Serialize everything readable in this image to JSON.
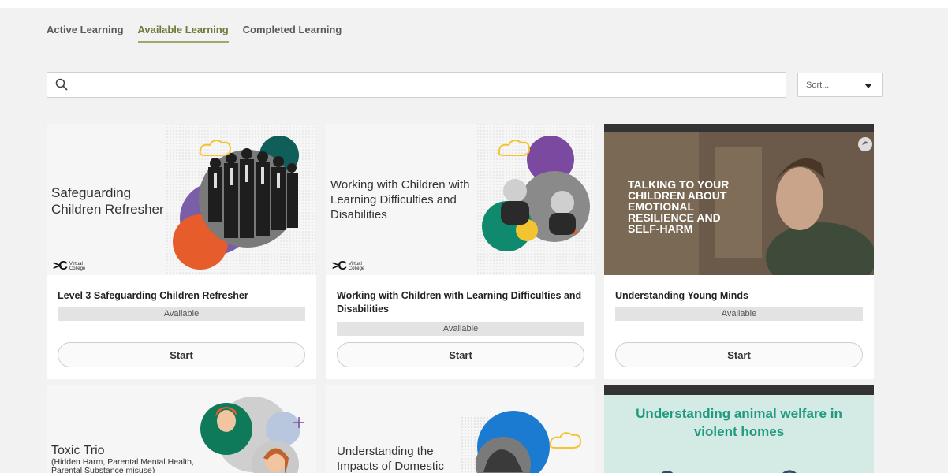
{
  "tabs": [
    {
      "label": "Active Learning",
      "active": false
    },
    {
      "label": "Available Learning",
      "active": true
    },
    {
      "label": "Completed Learning",
      "active": false
    }
  ],
  "search": {
    "placeholder": "",
    "value": ""
  },
  "sort": {
    "selected": "Sort..."
  },
  "cards": [
    {
      "image_title": "Safeguarding Children Refresher",
      "logo_line1": "Virtual",
      "logo_line2": "College",
      "title": "Level 3 Safeguarding Children Refresher",
      "status": "Available",
      "button": "Start"
    },
    {
      "image_title": "Working with Children with Learning Difficulties and Disabilities",
      "logo_line1": "Virtual",
      "logo_line2": "College",
      "title": "Working with Children with Learning Difficulties and Disabilities",
      "status": "Available",
      "button": "Start"
    },
    {
      "image_title": "TALKING TO YOUR CHILDREN ABOUT EMOTIONAL RESILIENCE AND SELF-HARM",
      "title": "Understanding Young Minds",
      "status": "Available",
      "button": "Start"
    },
    {
      "image_title": "Toxic Trio",
      "image_subtitle": "(Hidden Harm, Parental Mental Health, Parental Substance misuse)"
    },
    {
      "image_title": "Understanding the Impacts of Domestic"
    },
    {
      "image_title": "Understanding animal welfare in violent homes"
    }
  ],
  "colors": {
    "accent_highlight": "#f3f36e",
    "active_tab": "#6f7a3c",
    "status_bg": "#e3e3e3",
    "page_bg": "#f2f2f2",
    "teal": "#2a9d8f",
    "orange": "#e65c2a",
    "purple": "#7b4aa0",
    "yellow": "#f4c430"
  }
}
